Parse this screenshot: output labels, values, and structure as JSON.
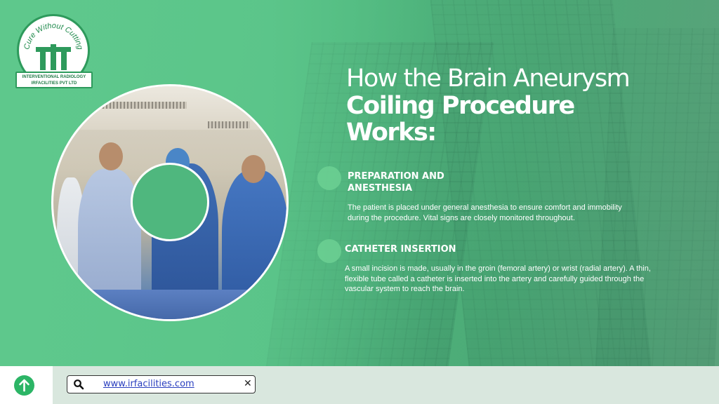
{
  "logo": {
    "ring_text": "Cure Without Cutting",
    "banner_line1": "INTERVENTIONAL RADIOLOGY",
    "banner_line2": "IRFACILITIES PVT LTD"
  },
  "title": {
    "line1": "How the Brain Aneurysm",
    "line2": "Coiling Procedure",
    "line3": "Works:"
  },
  "sections": [
    {
      "heading": "PREPARATION AND ANESTHESIA",
      "body": "The patient is placed under general anesthesia to ensure comfort and immobility during the procedure. Vital signs are closely monitored throughout."
    },
    {
      "heading": "CATHETER INSERTION",
      "body": "A small incision is made, usually in the groin (femoral artery) or wrist (radial artery). A thin, flexible tube called a catheter is inserted into the artery and carefully guided through the vascular system to reach the brain."
    }
  ],
  "bottom_bar": {
    "up_icon": "arrow-up-icon",
    "search_icon": "search-icon",
    "link_text": "www.irfacilities.com",
    "close_icon": "close-icon"
  },
  "colors": {
    "accent_green": "#2cb566",
    "background_green": "#5dc58c",
    "link_blue": "#2a3fbf"
  }
}
